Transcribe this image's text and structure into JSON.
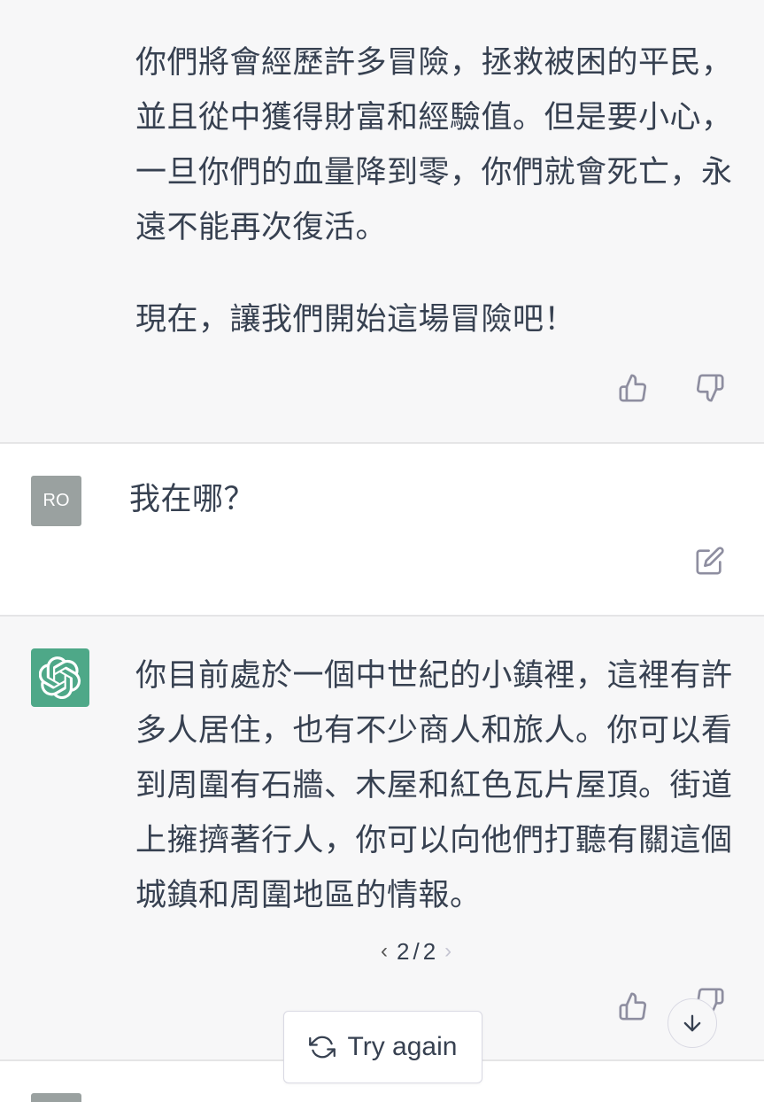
{
  "conversation": {
    "assistant_message_1": {
      "paragraph_1": "你們將會經歷許多冒險，拯救被困的平民，\n並且從中獲得財富和經驗值。但是要小心，\n一旦你們的血量降到零，你們就會死亡，永\n遠不能再次復活。",
      "paragraph_2": "現在，讓我們開始這場冒險吧！",
      "like_icon": "thumbs-up-icon",
      "dislike_icon": "thumbs-down-icon"
    },
    "user_message": {
      "avatar_initials": "RO",
      "text": "我在哪？",
      "edit_icon": "edit-icon"
    },
    "assistant_message_2": {
      "text": "你目前處於一個中世紀的小鎮裡，這裡有許\n多人居住，也有不少商人和旅人。你可以看\n到周圍有石牆、木屋和紅色瓦片屋頂。街道\n上擁擠著行人，你可以向他們打聽有關這個\n城鎮和周圍地區的情報。",
      "pager": {
        "prev": "‹",
        "current": "2",
        "separator": "/",
        "total": "2",
        "next": "›"
      },
      "avatar_icon": "openai-logo-icon",
      "avatar_color": "#4ea888"
    }
  },
  "controls": {
    "try_again_label": "Try again",
    "try_again_icon": "refresh-icon",
    "scroll_down_icon": "arrow-down-icon"
  },
  "colors": {
    "assistant_bg": "#f7f7f8",
    "user_bg": "#ffffff",
    "user_avatar": "#9aa1a0"
  }
}
